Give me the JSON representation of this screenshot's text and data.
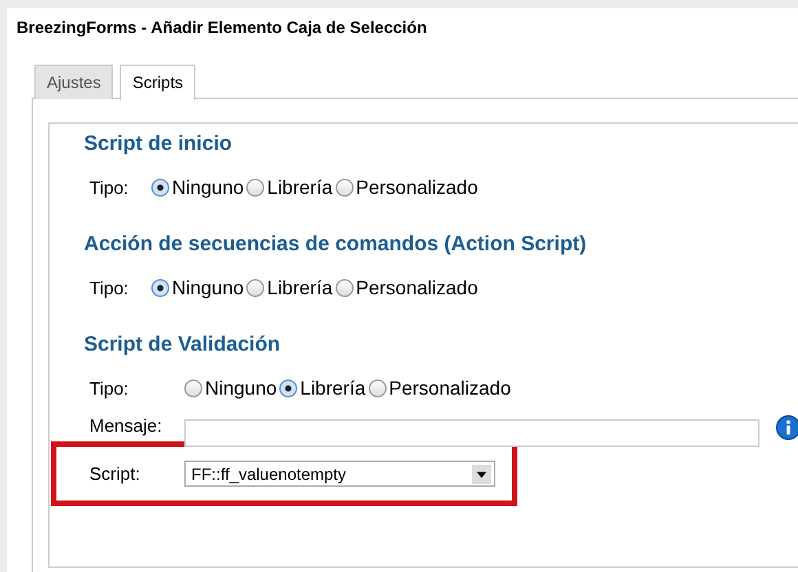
{
  "window": {
    "title": "BreezingForms - Añadir Elemento Caja de Selección"
  },
  "tabs": [
    {
      "label": "Ajustes",
      "selected": false
    },
    {
      "label": "Scripts",
      "selected": true
    }
  ],
  "sections": [
    {
      "heading": "Script de inicio",
      "type_label": "Tipo:",
      "options": [
        {
          "label": "Ninguno",
          "selected": true
        },
        {
          "label": "Librería",
          "selected": false
        },
        {
          "label": "Personalizado",
          "selected": false
        }
      ]
    },
    {
      "heading": "Acción de secuencias de comandos (Action Script)",
      "type_label": "Tipo:",
      "options": [
        {
          "label": "Ninguno",
          "selected": true
        },
        {
          "label": "Librería",
          "selected": false
        },
        {
          "label": "Personalizado",
          "selected": false
        }
      ]
    },
    {
      "heading": "Script de Validación",
      "type_label": "Tipo:",
      "options": [
        {
          "label": "Ninguno",
          "selected": false
        },
        {
          "label": "Librería",
          "selected": true
        },
        {
          "label": "Personalizado",
          "selected": false
        }
      ],
      "fields": [
        {
          "kind": "text",
          "label": "Mensaje:",
          "highlighted": false
        },
        {
          "kind": "select",
          "label": "Script:",
          "value": "FF::ff_valuenotempty",
          "highlighted": true
        }
      ]
    }
  ]
}
